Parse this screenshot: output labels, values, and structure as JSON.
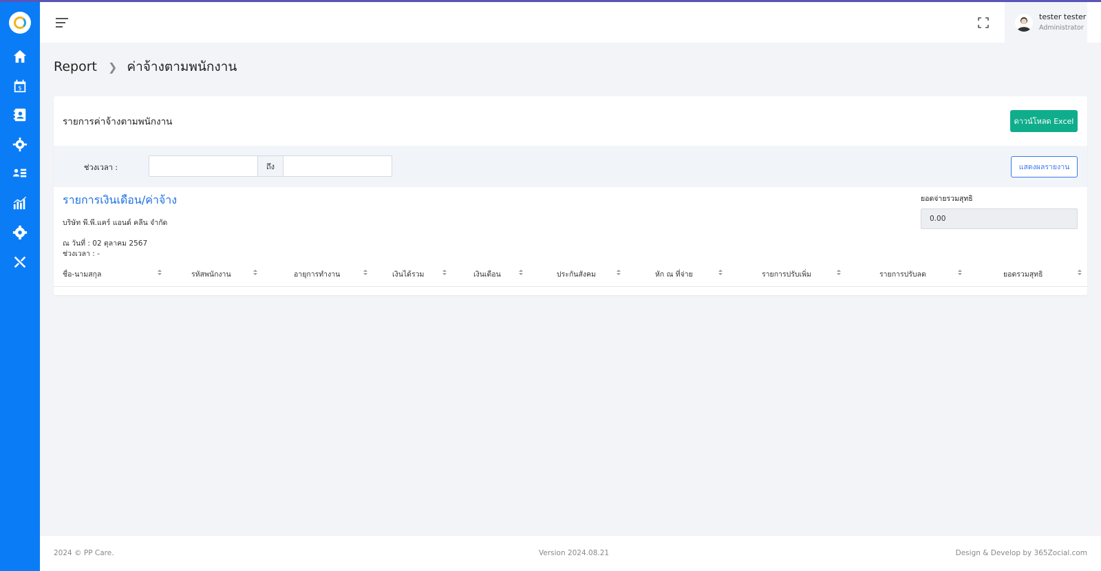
{
  "header": {
    "user_name": "tester tester",
    "user_role": "Administrator"
  },
  "sidebar": {
    "items": [
      {
        "icon": "home-icon"
      },
      {
        "icon": "calendar-money-icon"
      },
      {
        "icon": "contact-book-icon"
      },
      {
        "icon": "users-gear-icon"
      },
      {
        "icon": "user-list-icon"
      },
      {
        "icon": "chart-icon"
      },
      {
        "icon": "gear-icon"
      },
      {
        "icon": "tools-icon"
      }
    ]
  },
  "breadcrumb": {
    "parent": "Report",
    "current": "ค่าจ้างตามพนักงาน"
  },
  "card": {
    "title": "รายการค่าจ้างตามพนักงาน",
    "excel_button": "ดาวน์โหลด Excel"
  },
  "filter": {
    "label": "ช่วงเวลา :",
    "from_value": "",
    "to_label": "ถึง",
    "to_value": "",
    "show_button": "แสดงผลรายงาน"
  },
  "report": {
    "title": "รายการเงินเดือน/ค่าจ้าง",
    "company": "บริษัท พี.พี.แคร์ แอนด์ คลีน จำกัด",
    "date": "ณ วันที่ : 02 ตุลาคม 2567",
    "period": "ช่วงเวลา : -",
    "net_label": "ยอดจ่ายรวมสุทธิ",
    "net_value": "0.00"
  },
  "table": {
    "columns": [
      "ชื่อ-นามสกุล",
      "รหัสพนักงาน",
      "อายุการทำงาน",
      "เงินได้รวม",
      "เงินเดือน",
      "ประกันสังคม",
      "หัก ณ ที่จ่าย",
      "รายการปรับเพิ่ม",
      "รายการปรับลด",
      "ยอดรวมสุทธิ"
    ],
    "rows": []
  },
  "footer": {
    "copyright": "2024 © PP Care.",
    "version": "Version 2024.08.21",
    "credit": "Design & Develop by 365Zocial.com"
  },
  "colors": {
    "sidebar": "#0a7cf6",
    "primary": "#3a78f2",
    "excel_button": "#10ad8c",
    "report_title": "#1b6fe4"
  }
}
